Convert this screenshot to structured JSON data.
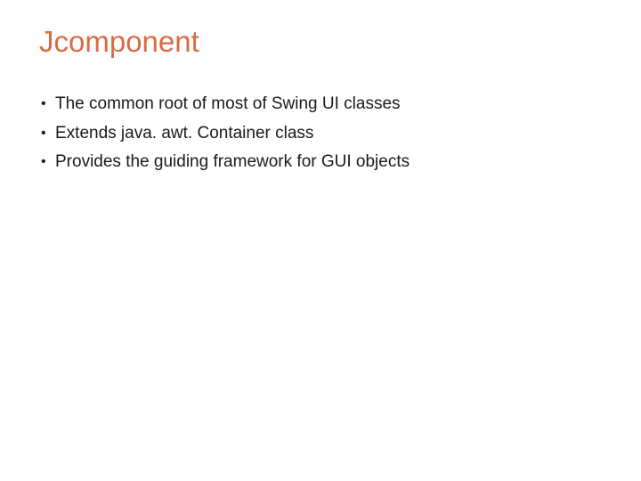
{
  "title": "Jcomponent",
  "bullets": [
    "The common root of most of Swing UI classes",
    "Extends java. awt. Container class",
    "Provides the guiding framework for GUI objects"
  ]
}
